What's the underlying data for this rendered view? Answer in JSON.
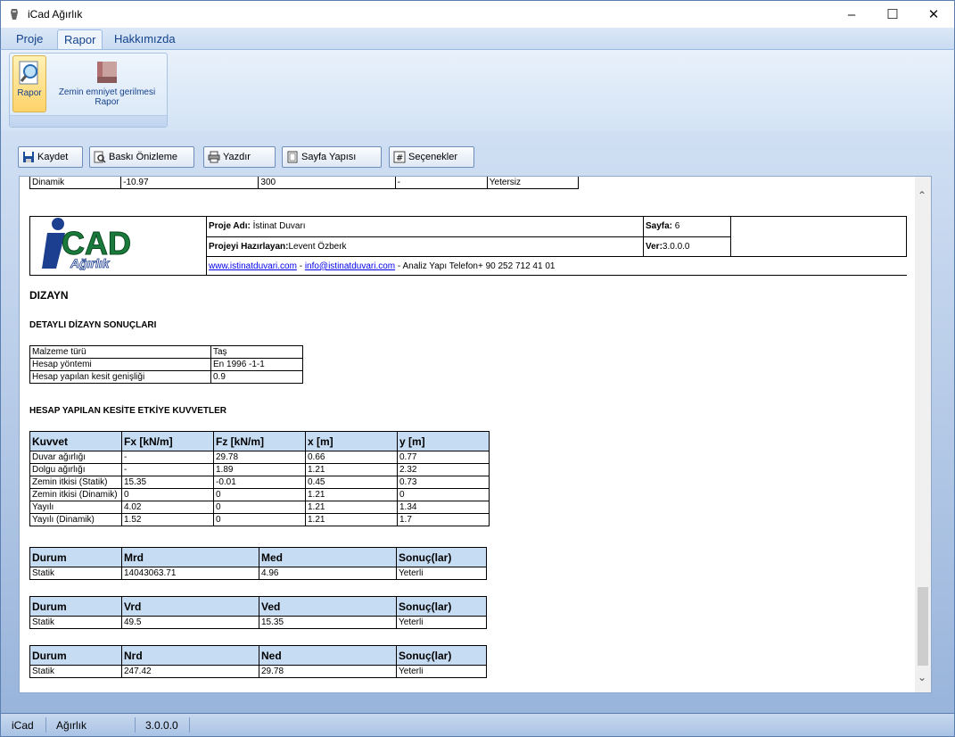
{
  "window": {
    "title": "iCad Ağırlık"
  },
  "ribbon": {
    "tabs": [
      "Proje",
      "Rapor",
      "Hakkımızda"
    ],
    "buttons": {
      "rapor": "Rapor",
      "zemin_line1": "Zemin emniyet gerilmesi",
      "zemin_line2": "Rapor"
    }
  },
  "toolbar": {
    "kaydet": "Kaydet",
    "baski": "Baskı Önizleme",
    "yazdir": "Yazdır",
    "sayfa": "Sayfa Yapısı",
    "secenekler": "Seçenekler"
  },
  "report": {
    "top_row": [
      "Dinamik",
      "-10.97",
      "300",
      "-",
      "Yetersiz"
    ],
    "header": {
      "logo_main": "iCAD",
      "logo_sub": "Ağırlık",
      "proje_adi_label": "Proje Adı:",
      "proje_adi": " İstinat Duvarı",
      "hazirlayan_label": "Projeyi Hazırlayan:",
      "hazirlayan": "Levent Özberk",
      "sayfa_label": "Sayfa:",
      "sayfa": " 6",
      "ver_label": "Ver:",
      "ver": "3.0.0.0",
      "web": "www.istinatduvari.com",
      "sep1": " - ",
      "email": "info@istinatduvari.com",
      "contact": " - Analiz Yapı Telefon+ 90 252 712 41 01"
    },
    "dizayn_title": "DIZAYN",
    "detayli_title": "DETAYLI DİZAYN SONUÇLARI",
    "props": [
      [
        "Malzeme türü",
        "Taş"
      ],
      [
        "Hesap yöntemi",
        "En 1996 -1-1"
      ],
      [
        "Hesap yapılan kesit genişliği",
        "0.9"
      ]
    ],
    "kuvvet_title": "HESAP YAPILAN KESİTE ETKİYE KUVVETLER",
    "forces": {
      "headers": [
        "Kuvvet",
        "Fx [kN/m]",
        "Fz [kN/m]",
        "x [m]",
        "y [m]"
      ],
      "rows": [
        [
          "Duvar ağırlığı",
          "-",
          "29.78",
          "0.66",
          "0.77"
        ],
        [
          "Dolgu ağırlığı",
          "-",
          "1.89",
          "1.21",
          "2.32"
        ],
        [
          "Zemin itkisi (Statik)",
          "15.35",
          "-0.01",
          "0.45",
          "0.73"
        ],
        [
          "Zemin itkisi (Dinamik)",
          "0",
          "0",
          "1.21",
          "0"
        ],
        [
          "Yayılı",
          "4.02",
          "0",
          "1.21",
          "1.34"
        ],
        [
          "Yayılı (Dinamik)",
          "1.52",
          "0",
          "1.21",
          "1.7"
        ]
      ]
    },
    "moment": {
      "headers": [
        "Durum",
        "Mrd",
        "Med",
        "Sonuç(lar)"
      ],
      "row": [
        "Statik",
        "14043063.71",
        "4.96",
        "Yeterli"
      ]
    },
    "shear": {
      "headers": [
        "Durum",
        "Vrd",
        "Ved",
        "Sonuç(lar)"
      ],
      "row": [
        "Statik",
        "49.5",
        "15.35",
        "Yeterli"
      ]
    },
    "normal": {
      "headers": [
        "Durum",
        "Nrd",
        "Ned",
        "Sonuç(lar)"
      ],
      "row": [
        "Statik",
        "247.42",
        "29.78",
        "Yeterli"
      ]
    }
  },
  "status": {
    "app": "iCad",
    "module": "Ağırlık",
    "version": "3.0.0.0"
  }
}
